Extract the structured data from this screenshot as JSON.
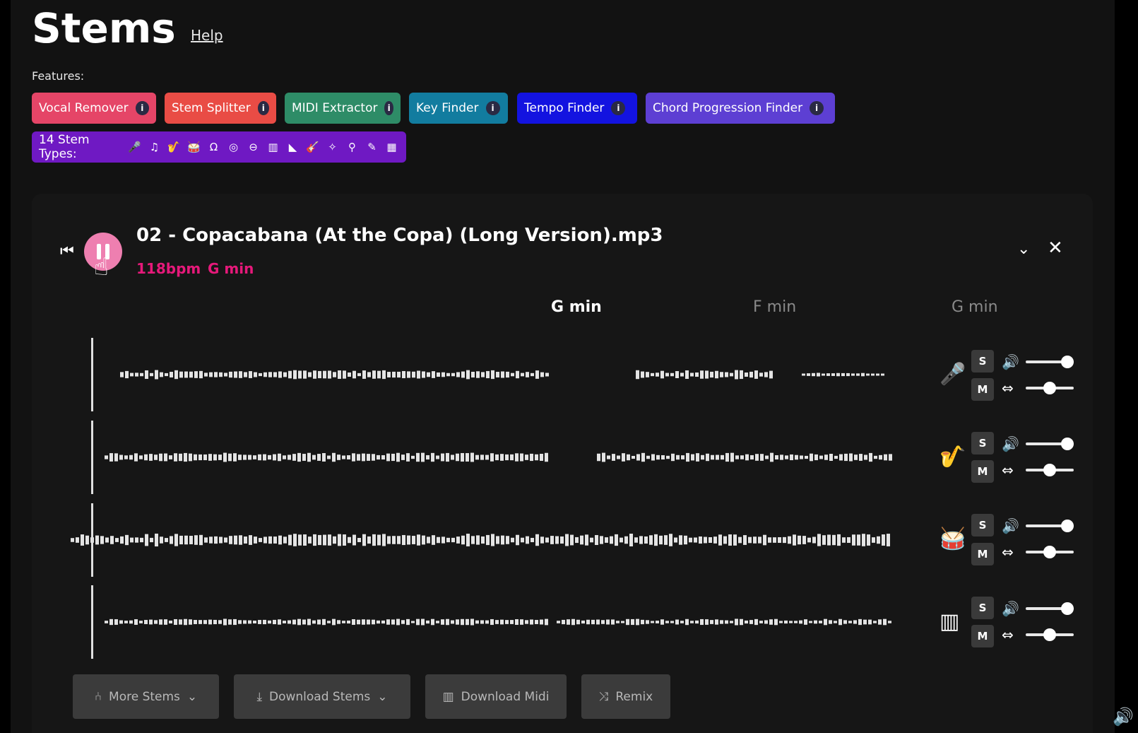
{
  "header": {
    "title": "Stems",
    "help_link": "Help",
    "features_label": "Features:"
  },
  "features": [
    {
      "label": "Vocal Remover",
      "color": "#e54567"
    },
    {
      "label": "Stem Splitter",
      "color": "#e94c45"
    },
    {
      "label": "MIDI Extractor",
      "color": "#2e8c67"
    },
    {
      "label": "Key Finder",
      "color": "#127c9f"
    },
    {
      "label": "Tempo Finder",
      "color": "#1313e0"
    },
    {
      "label": "Chord Progression Finder",
      "color": "#5d3fd3"
    }
  ],
  "info_glyph": "i",
  "stem_types": {
    "label": "14 Stem Types:",
    "icons": [
      "microphone-icon",
      "music-note-icon",
      "saxophone-icon",
      "drum-icon",
      "cymbal-icon",
      "kick-drum-icon",
      "snare-icon",
      "keyboard-icon",
      "piano-icon",
      "guitar-icon",
      "electric-guitar-icon",
      "bass-guitar-icon",
      "violin-icon",
      "synth-icon"
    ]
  },
  "track": {
    "filename": "02 - Copacabana (At the Copa) (Long Version).mp3",
    "bpm": "118bpm",
    "key": "G min",
    "state": "playing"
  },
  "chords": [
    {
      "label": "G min",
      "active": true
    },
    {
      "label": "F min",
      "active": false
    },
    {
      "label": "G min",
      "active": false
    }
  ],
  "stems": [
    {
      "icon": "microphone-icon",
      "solo": "S",
      "mute": "M",
      "volume": 1.0,
      "pan": 0.5
    },
    {
      "icon": "saxophone-icon",
      "solo": "S",
      "mute": "M",
      "volume": 1.0,
      "pan": 0.5
    },
    {
      "icon": "drum-icon",
      "solo": "S",
      "mute": "M",
      "volume": 1.0,
      "pan": 0.5
    },
    {
      "icon": "piano-icon",
      "solo": "S",
      "mute": "M",
      "volume": 1.0,
      "pan": 0.5
    }
  ],
  "actions": {
    "more_stems": "More Stems",
    "download_stems": "Download Stems",
    "download_midi": "Download Midi",
    "remix": "Remix"
  },
  "colors": {
    "accent": "#e6197a",
    "play_button": "#ee7fb0",
    "stem_types_bg": "#6f19c3"
  }
}
